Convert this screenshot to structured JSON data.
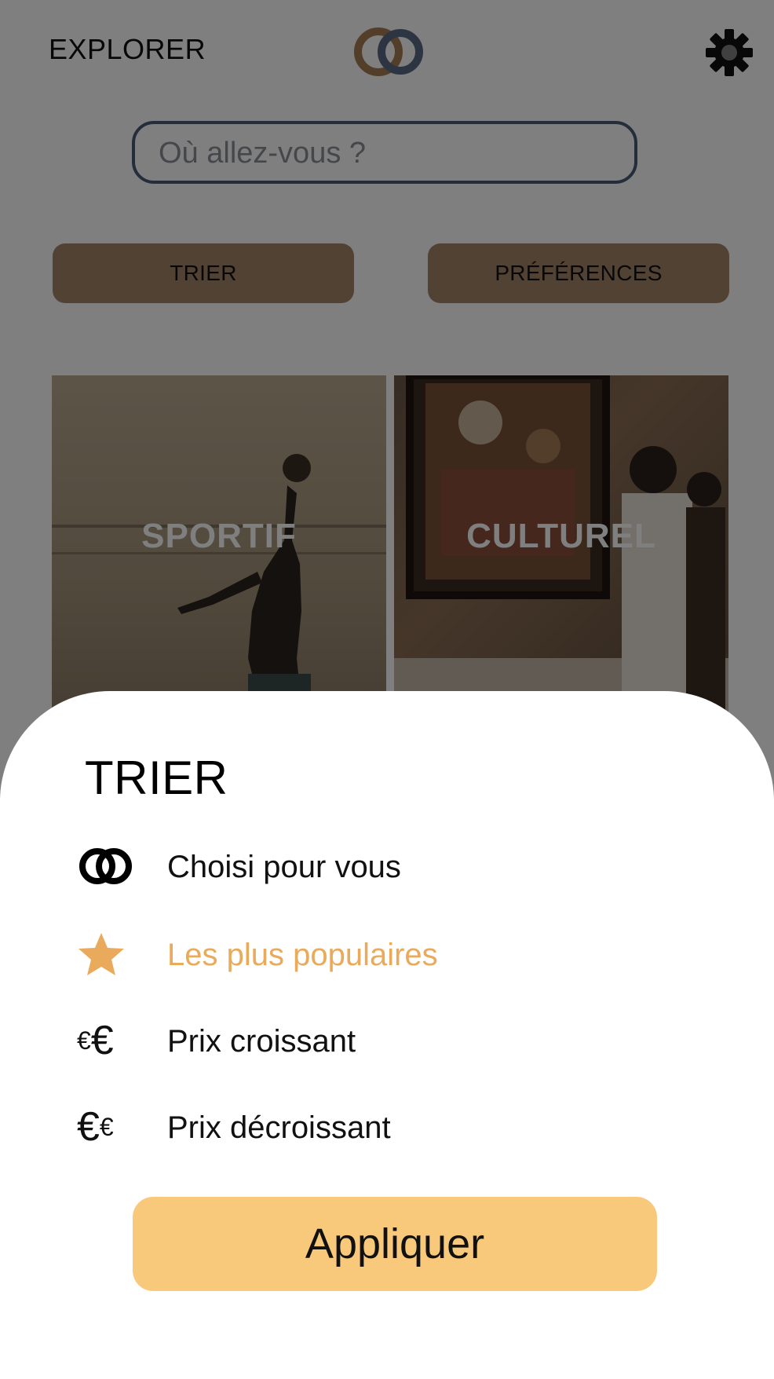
{
  "header": {
    "title": "EXPLORER"
  },
  "search": {
    "placeholder": "Où allez-vous ?"
  },
  "actions": {
    "sort_label": "TRIER",
    "preferences_label": "PRÉFÉRENCES"
  },
  "categories": [
    {
      "label": "SPORTIF"
    },
    {
      "label": "CULTUREL"
    }
  ],
  "sort_sheet": {
    "title": "TRIER",
    "options": [
      {
        "label": "Choisi pour vous",
        "icon": "app-logo-icon",
        "selected": false
      },
      {
        "label": "Les plus populaires",
        "icon": "star-icon",
        "selected": true
      },
      {
        "label": "Prix croissant",
        "icon": "euro-ascending-icon",
        "selected": false
      },
      {
        "label": "Prix décroissant",
        "icon": "euro-descending-icon",
        "selected": false
      }
    ],
    "apply_label": "Appliquer"
  },
  "colors": {
    "accent": "#e9aa5c",
    "apply_button": "#f9c97b",
    "pill_button": "#a48468",
    "search_border": "#4b5a76",
    "logo_brown": "#a67c52",
    "logo_blue": "#5a6a86"
  }
}
